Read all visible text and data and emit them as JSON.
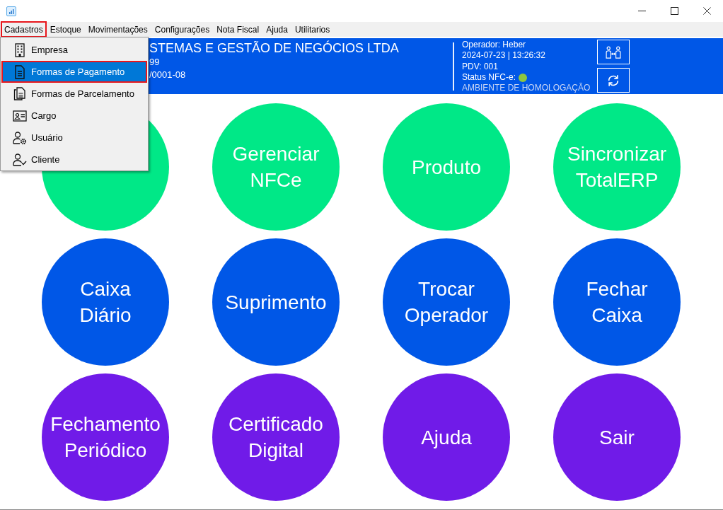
{
  "menu_bar": {
    "items": [
      {
        "label": "Cadastros",
        "selected": true
      },
      {
        "label": "Estoque",
        "selected": false
      },
      {
        "label": "Movimentações",
        "selected": false
      },
      {
        "label": "Configurações",
        "selected": false
      },
      {
        "label": "Nota Fiscal",
        "selected": false
      },
      {
        "label": "Ajuda",
        "selected": false
      },
      {
        "label": "Utilitarios",
        "selected": false
      }
    ]
  },
  "dropdown": {
    "items": [
      {
        "label": "Empresa",
        "kind": "building",
        "selected": false
      },
      {
        "label": "Formas de Pagamento",
        "kind": "document",
        "selected": true
      },
      {
        "label": "Formas de Parcelamento",
        "kind": "documents",
        "selected": false
      },
      {
        "label": "Cargo",
        "kind": "id-card",
        "selected": false
      },
      {
        "label": "Usuário",
        "kind": "user-gear",
        "selected": false
      },
      {
        "label": "Cliente",
        "kind": "user-check",
        "selected": false
      }
    ]
  },
  "header": {
    "company": {
      "name": "STEMAS E GESTÃO DE NEGÓCIOS LTDA",
      "line_2": "99",
      "line_3": "/0001-08"
    },
    "info_lines": [
      {
        "kind": "text",
        "text": "Operador: Heber"
      },
      {
        "kind": "text",
        "text": "2024-07-23 | 13:26:32"
      },
      {
        "kind": "text",
        "text": "PDV: 001"
      },
      {
        "kind": "status",
        "text": "Status NFC-e:",
        "color": "#8dc641"
      },
      {
        "kind": "note",
        "text": "AMBIENTE DE HOMOLOGAÇÃO"
      }
    ],
    "buttons": [
      {
        "kind": "people-arrows"
      },
      {
        "kind": "refresh"
      }
    ]
  },
  "tiles": [
    {
      "color": "#00e887"
    },
    {
      "label": "Gerenciar\nNFCe",
      "color": "#00e887"
    },
    {
      "label": "Produto",
      "color": "#00e887"
    },
    {
      "label": "Sincronizar\nTotalERP",
      "color": "#00e887"
    },
    {
      "label": "Caixa\nDiário",
      "color": "#0057e7"
    },
    {
      "label": "Suprimento",
      "color": "#0057e7"
    },
    {
      "label": "Trocar\nOperador",
      "color": "#0057e7"
    },
    {
      "label": "Fechar\nCaixa",
      "color": "#0057e7"
    },
    {
      "label": "Fechamento\nPeriódico",
      "color": "#701be8"
    },
    {
      "label": "Certificado\nDigital",
      "color": "#701be8"
    },
    {
      "label": "Ajuda",
      "color": "#701be8"
    },
    {
      "label": "Sair",
      "color": "#701be8"
    }
  ]
}
